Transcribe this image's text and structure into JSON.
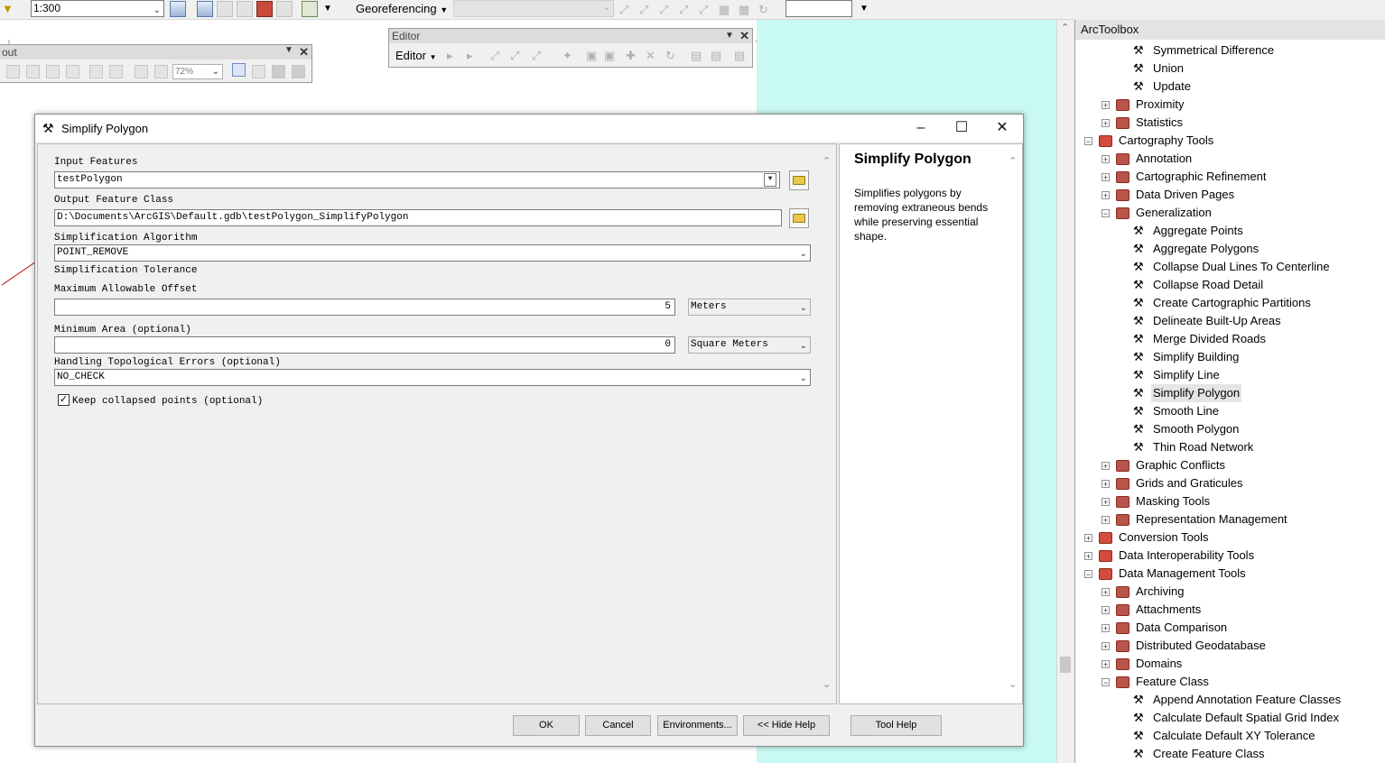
{
  "toolbar": {
    "scale": "1:300",
    "georeferencing_label": "Georeferencing",
    "layer_dropdown": ""
  },
  "layout_toolbar": {
    "title": "out",
    "zoom": "72%"
  },
  "editor_toolbar": {
    "title": "Editor",
    "menu_label": "Editor"
  },
  "dialog": {
    "title": "Simplify Polygon",
    "input_features_label": "Input Features",
    "input_features_value": "testPolygon",
    "output_label": "Output Feature Class",
    "output_value": "D:\\Documents\\ArcGIS\\Default.gdb\\testPolygon_SimplifyPolygon",
    "algorithm_label": "Simplification Algorithm",
    "algorithm_value": "POINT_REMOVE",
    "tolerance_label": "Simplification Tolerance",
    "max_offset_label": "Maximum Allowable Offset",
    "max_offset_value": "5",
    "max_offset_unit": "Meters",
    "min_area_label": "Minimum Area (optional)",
    "min_area_value": "0",
    "min_area_unit": "Square Meters",
    "topo_label": "Handling Topological Errors (optional)",
    "topo_value": "NO_CHECK",
    "keep_collapsed_label": "Keep collapsed points (optional)",
    "keep_collapsed_checked": true,
    "help_title": "Simplify Polygon",
    "help_text": "Simplifies polygons by removing extraneous bends while preserving essential shape.",
    "buttons": {
      "ok": "OK",
      "cancel": "Cancel",
      "environments": "Environments...",
      "hide_help": "<< Hide Help",
      "tool_help": "Tool Help"
    }
  },
  "arctoolbox": {
    "title": "ArcToolbox",
    "items": [
      {
        "label": "Symmetrical Difference",
        "kind": "tool",
        "level": 2
      },
      {
        "label": "Union",
        "kind": "tool",
        "level": 2
      },
      {
        "label": "Update",
        "kind": "tool",
        "level": 2
      },
      {
        "label": "Proximity",
        "kind": "toolset",
        "level": 1,
        "state": "+"
      },
      {
        "label": "Statistics",
        "kind": "toolset",
        "level": 1,
        "state": "+"
      },
      {
        "label": "Cartography Tools",
        "kind": "toolbox",
        "level": 0,
        "state": "-"
      },
      {
        "label": "Annotation",
        "kind": "toolset",
        "level": 1,
        "state": "+"
      },
      {
        "label": "Cartographic Refinement",
        "kind": "toolset",
        "level": 1,
        "state": "+"
      },
      {
        "label": "Data Driven Pages",
        "kind": "toolset",
        "level": 1,
        "state": "+"
      },
      {
        "label": "Generalization",
        "kind": "toolset",
        "level": 1,
        "state": "-"
      },
      {
        "label": "Aggregate Points",
        "kind": "tool",
        "level": 2
      },
      {
        "label": "Aggregate Polygons",
        "kind": "tool",
        "level": 2
      },
      {
        "label": "Collapse Dual Lines To Centerline",
        "kind": "tool",
        "level": 2
      },
      {
        "label": "Collapse Road Detail",
        "kind": "tool",
        "level": 2
      },
      {
        "label": "Create Cartographic Partitions",
        "kind": "tool",
        "level": 2
      },
      {
        "label": "Delineate Built-Up Areas",
        "kind": "tool",
        "level": 2
      },
      {
        "label": "Merge Divided Roads",
        "kind": "tool",
        "level": 2
      },
      {
        "label": "Simplify Building",
        "kind": "tool",
        "level": 2
      },
      {
        "label": "Simplify Line",
        "kind": "tool",
        "level": 2
      },
      {
        "label": "Simplify Polygon",
        "kind": "tool",
        "level": 2,
        "selected": true
      },
      {
        "label": "Smooth Line",
        "kind": "tool",
        "level": 2
      },
      {
        "label": "Smooth Polygon",
        "kind": "tool",
        "level": 2
      },
      {
        "label": "Thin Road Network",
        "kind": "tool",
        "level": 2
      },
      {
        "label": "Graphic Conflicts",
        "kind": "toolset",
        "level": 1,
        "state": "+"
      },
      {
        "label": "Grids and Graticules",
        "kind": "toolset",
        "level": 1,
        "state": "+"
      },
      {
        "label": "Masking Tools",
        "kind": "toolset",
        "level": 1,
        "state": "+"
      },
      {
        "label": "Representation Management",
        "kind": "toolset",
        "level": 1,
        "state": "+"
      },
      {
        "label": "Conversion Tools",
        "kind": "toolbox",
        "level": 0,
        "state": "+"
      },
      {
        "label": "Data Interoperability Tools",
        "kind": "toolbox",
        "level": 0,
        "state": "+"
      },
      {
        "label": "Data Management Tools",
        "kind": "toolbox",
        "level": 0,
        "state": "-"
      },
      {
        "label": "Archiving",
        "kind": "toolset",
        "level": 1,
        "state": "+"
      },
      {
        "label": "Attachments",
        "kind": "toolset",
        "level": 1,
        "state": "+"
      },
      {
        "label": "Data Comparison",
        "kind": "toolset",
        "level": 1,
        "state": "+"
      },
      {
        "label": "Distributed Geodatabase",
        "kind": "toolset",
        "level": 1,
        "state": "+"
      },
      {
        "label": "Domains",
        "kind": "toolset",
        "level": 1,
        "state": "+"
      },
      {
        "label": "Feature Class",
        "kind": "toolset",
        "level": 1,
        "state": "-"
      },
      {
        "label": "Append Annotation Feature Classes",
        "kind": "tool",
        "level": 2
      },
      {
        "label": "Calculate Default Spatial Grid Index",
        "kind": "tool",
        "level": 2
      },
      {
        "label": "Calculate Default XY Tolerance",
        "kind": "tool",
        "level": 2
      },
      {
        "label": "Create Feature Class",
        "kind": "tool",
        "level": 2
      }
    ]
  },
  "colors": {
    "map_cyan": "#c8f9f2",
    "map_line_red": "#c00000",
    "toolbox_red": "#d34b3c",
    "selected_bg": "#e5e5e5"
  }
}
